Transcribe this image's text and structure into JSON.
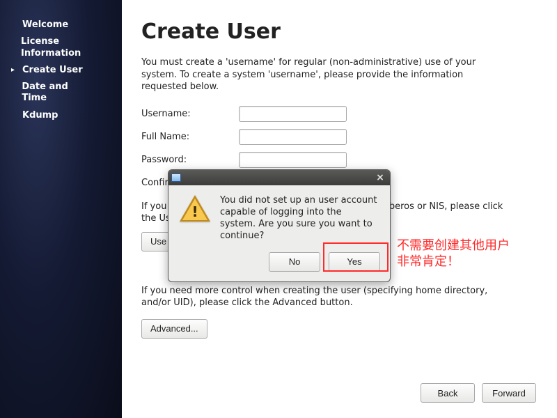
{
  "sidebar": {
    "items": [
      {
        "label": "Welcome"
      },
      {
        "label": "License Information"
      },
      {
        "label": "Create User"
      },
      {
        "label": "Date and Time"
      },
      {
        "label": "Kdump"
      }
    ],
    "active_index": 2
  },
  "page": {
    "title": "Create User",
    "intro": "You must create a 'username' for regular (non-administrative) use of your system.  To create a system 'username', please provide the information requested below.",
    "fields": {
      "username_label": "Username:",
      "username_value": "",
      "fullname_label": "Full Name:",
      "fullname_value": "",
      "password_label": "Password:",
      "password_value": "",
      "confirm_label": "Confirm Password:",
      "confirm_value": ""
    },
    "network_para": "If you need to use network authentication, such as Kerberos or NIS, please click the Use Network Login button.",
    "use_network_label": "Use Network Login...",
    "advanced_para": "If you need more control when creating the user (specifying home directory, and/or UID), please click the Advanced button.",
    "advanced_label": "Advanced...",
    "back_label": "Back",
    "forward_label": "Forward"
  },
  "dialog": {
    "message": "You did not set up an user account capable of logging into the system. Are you sure you want to continue?",
    "no_label": "No",
    "yes_label": "Yes"
  },
  "annotation": {
    "line1": "不需要创建其他用户",
    "line2": "非常肯定！"
  },
  "colors": {
    "annotation_red": "#ff2a2a"
  }
}
